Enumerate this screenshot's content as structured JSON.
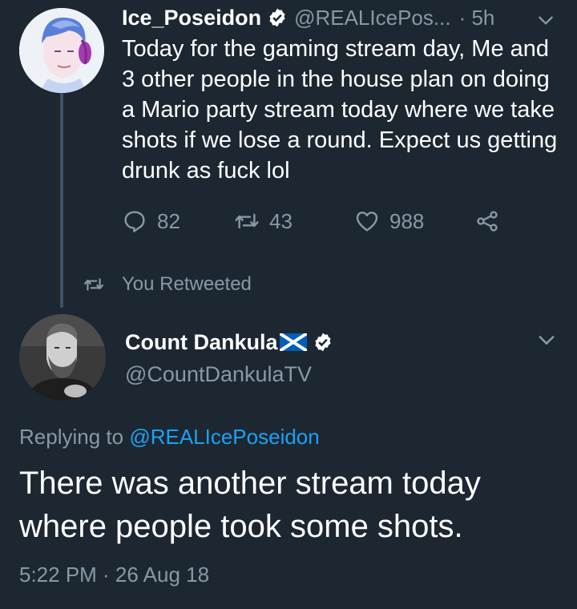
{
  "tweet": {
    "author_name": "Ice_Poseidon",
    "author_handle": "@REALIcePos...",
    "time_ago": "· 5h",
    "text": "Today for the gaming stream day, Me and 3 other people in the house plan on doing a Mario party stream today where we take shots if we lose a round. Expect us getting drunk as fuck lol",
    "replies": "82",
    "retweets": "43",
    "likes": "988"
  },
  "retweet_notice": "You Retweeted",
  "reply": {
    "author_name": "Count Dankula",
    "author_handle": "@CountDankulaTV",
    "replying_prefix": "Replying to",
    "replying_to": "@REALIcePoseidon",
    "text": "There was another stream today where people took some shots.",
    "timestamp": "5:22 PM · 26 Aug 18"
  },
  "colors": {
    "background": "#1c2732",
    "secondary_text": "#8899a6",
    "link": "#1da1f2"
  },
  "icons": [
    "verified-badge-icon",
    "chevron-down-icon",
    "reply-icon",
    "retweet-icon",
    "like-icon",
    "share-icon",
    "scotland-flag-icon"
  ]
}
